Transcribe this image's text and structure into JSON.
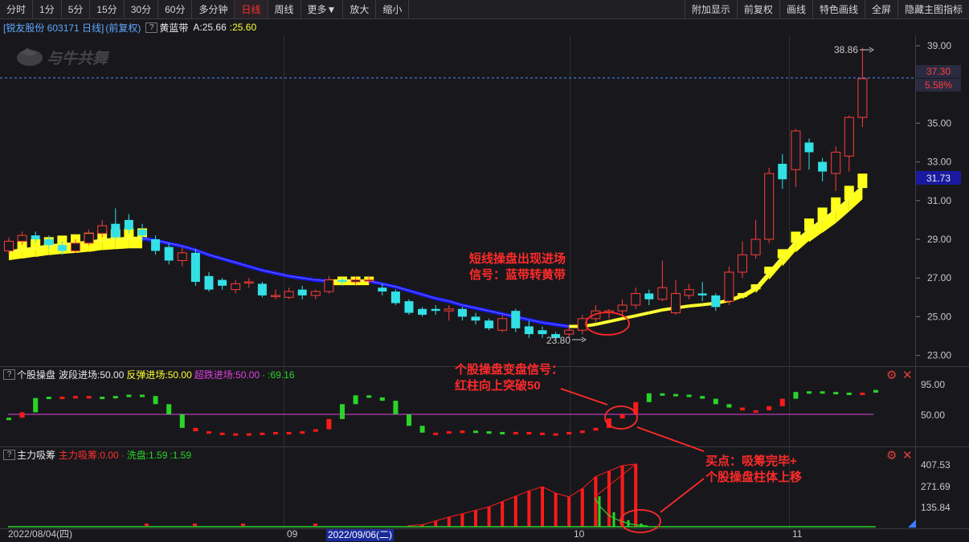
{
  "toolbar": {
    "left": [
      {
        "label": "分时",
        "active": false
      },
      {
        "label": "1分",
        "active": false
      },
      {
        "label": "5分",
        "active": false
      },
      {
        "label": "15分",
        "active": false
      },
      {
        "label": "30分",
        "active": false
      },
      {
        "label": "60分",
        "active": false
      },
      {
        "label": "多分钟",
        "active": false
      },
      {
        "label": "日线",
        "active": true
      },
      {
        "label": "周线",
        "active": false
      },
      {
        "label": "更多▼",
        "active": false
      },
      {
        "label": "放大",
        "active": false
      },
      {
        "label": "缩小",
        "active": false
      }
    ],
    "right": [
      {
        "label": "附加显示"
      },
      {
        "label": "前复权"
      },
      {
        "label": "画线"
      },
      {
        "label": "特色画线"
      },
      {
        "label": "全屏"
      },
      {
        "label": "隐藏主图指标"
      }
    ]
  },
  "main_panel": {
    "stock_name": "[锐友股份 603171 日线]",
    "adjust": "(前复权)",
    "indicator_name": "黄蓝带",
    "value_a_label": "A:25.66",
    "value_b": ":25.60",
    "value_b_color": "#ffff33",
    "watermark": "与牛共舞",
    "price_ticks": [
      "39.00",
      "35.00",
      "33.00",
      "31.00",
      "29.00",
      "27.00",
      "25.00",
      "23.00"
    ],
    "high_label": "38.86",
    "low_label": "23.80",
    "last_price": "37.30",
    "last_change": "5.58%",
    "band_value": "31.73",
    "annotation_1": [
      "短线操盘出现进场",
      "信号：蓝带转黄带"
    ]
  },
  "panel2": {
    "name": "个股操盘",
    "items": [
      {
        "text": "波段进场:50.00",
        "color": "#e8e8e8"
      },
      {
        "text": "反弹进场:50.00",
        "color": "#ffff33"
      },
      {
        "text": "超跌进场:50.00",
        "color": "#e040e0"
      },
      {
        "text": "·",
        "color": "#2ad42a"
      },
      {
        "text": ":69.16",
        "color": "#2ad42a"
      }
    ],
    "ticks": [
      "95.00",
      "50.00"
    ],
    "annotation": [
      "个股操盘变盘信号：",
      "红柱向上突破50"
    ]
  },
  "panel3": {
    "name": "主力吸筹",
    "items": [
      {
        "text": "主力吸筹:0.00",
        "color": "#ff3030"
      },
      {
        "text": "·",
        "color": "#ff3030"
      },
      {
        "text": "洗盘:1.59",
        "color": "#2ad42a"
      },
      {
        "text": ":1.59",
        "color": "#2ad42a"
      }
    ],
    "ticks": [
      "407.53",
      "271.69",
      "135.84"
    ],
    "annotation": [
      "买点：吸筹完毕+",
      "个股操盘柱体上移"
    ]
  },
  "date_axis": {
    "start": "2022/08/04(四)",
    "cursor": "2022/09/06(二)",
    "months": [
      "09",
      "10",
      "11"
    ]
  },
  "colors": {
    "up": "#ff3b3b",
    "down": "#33e0e6",
    "blue_band": "#1a1aff",
    "yellow_band": "#ffff1a"
  },
  "chart_data": {
    "type": "candlestick",
    "ylim": [
      23,
      39.6
    ],
    "candles": [
      {
        "o": 28.4,
        "c": 28.9,
        "h": 29.1,
        "l": 28.2
      },
      {
        "o": 28.9,
        "c": 29.2,
        "h": 29.4,
        "l": 28.7
      },
      {
        "o": 29.2,
        "c": 29.0,
        "h": 29.4,
        "l": 28.8
      },
      {
        "o": 29.0,
        "c": 28.7,
        "h": 29.2,
        "l": 28.5
      },
      {
        "o": 28.7,
        "c": 28.4,
        "h": 28.9,
        "l": 28.2
      },
      {
        "o": 28.4,
        "c": 28.8,
        "h": 29.0,
        "l": 28.3
      },
      {
        "o": 28.8,
        "c": 29.3,
        "h": 29.5,
        "l": 28.7
      },
      {
        "o": 29.3,
        "c": 29.7,
        "h": 30.0,
        "l": 29.1
      },
      {
        "o": 29.8,
        "c": 29.1,
        "h": 30.6,
        "l": 29.0
      },
      {
        "o": 30.0,
        "c": 29.5,
        "h": 30.3,
        "l": 29.3
      },
      {
        "o": 29.5,
        "c": 29.2,
        "h": 29.8,
        "l": 28.9
      },
      {
        "o": 29.0,
        "c": 28.4,
        "h": 29.2,
        "l": 28.2
      },
      {
        "o": 28.6,
        "c": 27.9,
        "h": 28.8,
        "l": 27.7
      },
      {
        "o": 27.9,
        "c": 28.3,
        "h": 28.6,
        "l": 27.6
      },
      {
        "o": 28.3,
        "c": 26.8,
        "h": 28.5,
        "l": 26.6
      },
      {
        "o": 27.1,
        "c": 26.4,
        "h": 27.3,
        "l": 26.3
      },
      {
        "o": 26.9,
        "c": 26.6,
        "h": 27.0,
        "l": 26.4
      },
      {
        "o": 26.4,
        "c": 26.7,
        "h": 26.9,
        "l": 26.2
      },
      {
        "o": 26.8,
        "c": 26.8,
        "h": 27.0,
        "l": 26.5
      },
      {
        "o": 26.7,
        "c": 26.1,
        "h": 26.8,
        "l": 26.0
      },
      {
        "o": 26.1,
        "c": 26.1,
        "h": 26.4,
        "l": 25.9
      },
      {
        "o": 26.0,
        "c": 26.3,
        "h": 26.5,
        "l": 25.9
      },
      {
        "o": 26.4,
        "c": 26.1,
        "h": 26.6,
        "l": 25.9
      },
      {
        "o": 26.1,
        "c": 26.3,
        "h": 26.4,
        "l": 25.9
      },
      {
        "o": 26.3,
        "c": 26.9,
        "h": 27.1,
        "l": 26.2
      },
      {
        "o": 26.9,
        "c": 26.8,
        "h": 27.0,
        "l": 26.6
      },
      {
        "o": 26.8,
        "c": 26.9,
        "h": 27.1,
        "l": 26.6
      },
      {
        "o": 26.9,
        "c": 26.9,
        "h": 27.1,
        "l": 26.7
      },
      {
        "o": 26.5,
        "c": 26.3,
        "h": 26.7,
        "l": 26.1
      },
      {
        "o": 26.3,
        "c": 25.7,
        "h": 26.4,
        "l": 25.6
      },
      {
        "o": 25.8,
        "c": 25.2,
        "h": 25.9,
        "l": 25.1
      },
      {
        "o": 25.4,
        "c": 25.1,
        "h": 25.5,
        "l": 25.0
      },
      {
        "o": 25.4,
        "c": 25.3,
        "h": 25.6,
        "l": 25.1
      },
      {
        "o": 25.3,
        "c": 25.4,
        "h": 25.6,
        "l": 24.8
      },
      {
        "o": 25.4,
        "c": 25.0,
        "h": 25.5,
        "l": 24.8
      },
      {
        "o": 25.0,
        "c": 24.8,
        "h": 25.2,
        "l": 24.6
      },
      {
        "o": 24.8,
        "c": 24.4,
        "h": 24.9,
        "l": 24.3
      },
      {
        "o": 24.3,
        "c": 24.9,
        "h": 25.1,
        "l": 24.2
      },
      {
        "o": 25.3,
        "c": 24.4,
        "h": 25.4,
        "l": 24.2
      },
      {
        "o": 24.5,
        "c": 24.1,
        "h": 24.8,
        "l": 23.9
      },
      {
        "o": 24.3,
        "c": 24.1,
        "h": 24.5,
        "l": 23.9
      },
      {
        "o": 24.1,
        "c": 23.9,
        "h": 24.2,
        "l": 23.8
      },
      {
        "o": 24.1,
        "c": 24.3,
        "h": 24.5,
        "l": 23.9
      },
      {
        "o": 24.3,
        "c": 24.9,
        "h": 25.1,
        "l": 24.1
      },
      {
        "o": 24.9,
        "c": 25.3,
        "h": 25.6,
        "l": 24.7
      },
      {
        "o": 25.2,
        "c": 25.3,
        "h": 25.4,
        "l": 24.9
      },
      {
        "o": 25.3,
        "c": 25.6,
        "h": 25.9,
        "l": 25.1
      },
      {
        "o": 25.6,
        "c": 26.2,
        "h": 26.5,
        "l": 25.4
      },
      {
        "o": 26.2,
        "c": 25.9,
        "h": 26.4,
        "l": 25.6
      },
      {
        "o": 25.9,
        "c": 26.5,
        "h": 27.9,
        "l": 25.8
      },
      {
        "o": 25.2,
        "c": 26.2,
        "h": 26.9,
        "l": 25.1
      },
      {
        "o": 26.1,
        "c": 26.4,
        "h": 26.7,
        "l": 25.9
      },
      {
        "o": 26.2,
        "c": 26.1,
        "h": 26.8,
        "l": 25.8
      },
      {
        "o": 26.1,
        "c": 25.5,
        "h": 26.2,
        "l": 25.3
      },
      {
        "o": 25.8,
        "c": 27.3,
        "h": 27.6,
        "l": 25.6
      },
      {
        "o": 27.3,
        "c": 28.2,
        "h": 28.9,
        "l": 27.0
      },
      {
        "o": 28.2,
        "c": 29.0,
        "h": 30.0,
        "l": 28.0
      },
      {
        "o": 29.0,
        "c": 32.4,
        "h": 32.7,
        "l": 28.8
      },
      {
        "o": 32.9,
        "c": 32.1,
        "h": 33.4,
        "l": 31.6
      },
      {
        "o": 32.6,
        "c": 34.6,
        "h": 34.7,
        "l": 31.7
      },
      {
        "o": 34.0,
        "c": 33.5,
        "h": 34.2,
        "l": 32.6
      },
      {
        "o": 33.0,
        "c": 32.5,
        "h": 33.2,
        "l": 32.0
      },
      {
        "o": 32.4,
        "c": 33.5,
        "h": 33.8,
        "l": 31.5
      },
      {
        "o": 33.3,
        "c": 35.3,
        "h": 35.4,
        "l": 32.5
      },
      {
        "o": 35.3,
        "c": 37.3,
        "h": 38.9,
        "l": 34.8
      }
    ],
    "band": [
      {
        "v": 28.35,
        "c": "y"
      },
      {
        "v": 28.45,
        "c": "y"
      },
      {
        "v": 28.55,
        "c": "y"
      },
      {
        "v": 28.65,
        "c": "y"
      },
      {
        "v": 28.72,
        "c": "y"
      },
      {
        "v": 28.78,
        "c": "y"
      },
      {
        "v": 28.85,
        "c": "y"
      },
      {
        "v": 28.95,
        "c": "y"
      },
      {
        "v": 29.0,
        "c": "y"
      },
      {
        "v": 29.05,
        "c": "y"
      },
      {
        "v": 29.05,
        "c": "y"
      },
      {
        "v": 28.95,
        "c": "b"
      },
      {
        "v": 28.8,
        "c": "b"
      },
      {
        "v": 28.65,
        "c": "b"
      },
      {
        "v": 28.45,
        "c": "b"
      },
      {
        "v": 28.2,
        "c": "b"
      },
      {
        "v": 28.0,
        "c": "b"
      },
      {
        "v": 27.8,
        "c": "b"
      },
      {
        "v": 27.6,
        "c": "b"
      },
      {
        "v": 27.4,
        "c": "b"
      },
      {
        "v": 27.25,
        "c": "b"
      },
      {
        "v": 27.1,
        "c": "b"
      },
      {
        "v": 27.0,
        "c": "b"
      },
      {
        "v": 26.9,
        "c": "b"
      },
      {
        "v": 26.85,
        "c": "b"
      },
      {
        "v": 26.85,
        "c": "y"
      },
      {
        "v": 26.85,
        "c": "y"
      },
      {
        "v": 26.85,
        "c": "y"
      },
      {
        "v": 26.7,
        "c": "b"
      },
      {
        "v": 26.55,
        "c": "b"
      },
      {
        "v": 26.35,
        "c": "b"
      },
      {
        "v": 26.15,
        "c": "b"
      },
      {
        "v": 25.95,
        "c": "b"
      },
      {
        "v": 25.8,
        "c": "b"
      },
      {
        "v": 25.6,
        "c": "b"
      },
      {
        "v": 25.45,
        "c": "b"
      },
      {
        "v": 25.3,
        "c": "b"
      },
      {
        "v": 25.15,
        "c": "b"
      },
      {
        "v": 25.0,
        "c": "b"
      },
      {
        "v": 24.85,
        "c": "b"
      },
      {
        "v": 24.7,
        "c": "b"
      },
      {
        "v": 24.6,
        "c": "b"
      },
      {
        "v": 24.5,
        "c": "b"
      },
      {
        "v": 24.5,
        "c": "y"
      },
      {
        "v": 24.6,
        "c": "y"
      },
      {
        "v": 24.75,
        "c": "y"
      },
      {
        "v": 24.9,
        "c": "y"
      },
      {
        "v": 25.05,
        "c": "y"
      },
      {
        "v": 25.2,
        "c": "y"
      },
      {
        "v": 25.35,
        "c": "y"
      },
      {
        "v": 25.45,
        "c": "y"
      },
      {
        "v": 25.55,
        "c": "y"
      },
      {
        "v": 25.62,
        "c": "y"
      },
      {
        "v": 25.7,
        "c": "y"
      },
      {
        "v": 25.85,
        "c": "y"
      },
      {
        "v": 26.1,
        "c": "y"
      },
      {
        "v": 26.5,
        "c": "y"
      },
      {
        "v": 27.3,
        "c": "y"
      },
      {
        "v": 28.1,
        "c": "y"
      },
      {
        "v": 28.9,
        "c": "y"
      },
      {
        "v": 29.5,
        "c": "y"
      },
      {
        "v": 30.0,
        "c": "y"
      },
      {
        "v": 30.5,
        "c": "y"
      },
      {
        "v": 31.1,
        "c": "y"
      },
      {
        "v": 31.73,
        "c": "y"
      }
    ],
    "panel2_values": [
      45,
      53,
      74,
      76,
      75,
      77,
      74,
      76,
      77,
      79,
      77,
      65,
      50,
      30,
      25,
      23,
      22,
      21,
      22,
      23,
      24,
      24,
      25,
      28,
      43,
      65,
      78,
      75,
      70,
      50,
      33,
      23,
      22,
      25,
      26,
      25,
      24,
      22,
      24,
      23,
      22,
      22,
      24,
      26,
      30,
      44,
      50,
      68,
      81,
      80,
      79,
      77,
      73,
      65,
      60,
      56,
      56,
      62,
      73,
      83,
      84,
      83,
      82,
      80,
      82,
      86
    ],
    "panel2_colors": "gregrrrgggggggrrrrrrrrrrrgggggggrrrgggrrrrrrrrrrgggggggrrrrgggggr",
    "panel3_xi": [
      30,
      31,
      32,
      33,
      34,
      35,
      36,
      37,
      38,
      39,
      40,
      41,
      42,
      43,
      44,
      45,
      46,
      47
    ],
    "panel3_red": [
      8,
      13,
      38,
      63,
      85,
      108,
      130,
      165,
      200,
      235,
      262,
      220,
      195,
      250,
      328,
      365,
      400,
      410
    ],
    "panel3_green": [
      0,
      0,
      0,
      0,
      0,
      0,
      0,
      0,
      0,
      0,
      0,
      0,
      0,
      0,
      0,
      0,
      0,
      0
    ]
  }
}
